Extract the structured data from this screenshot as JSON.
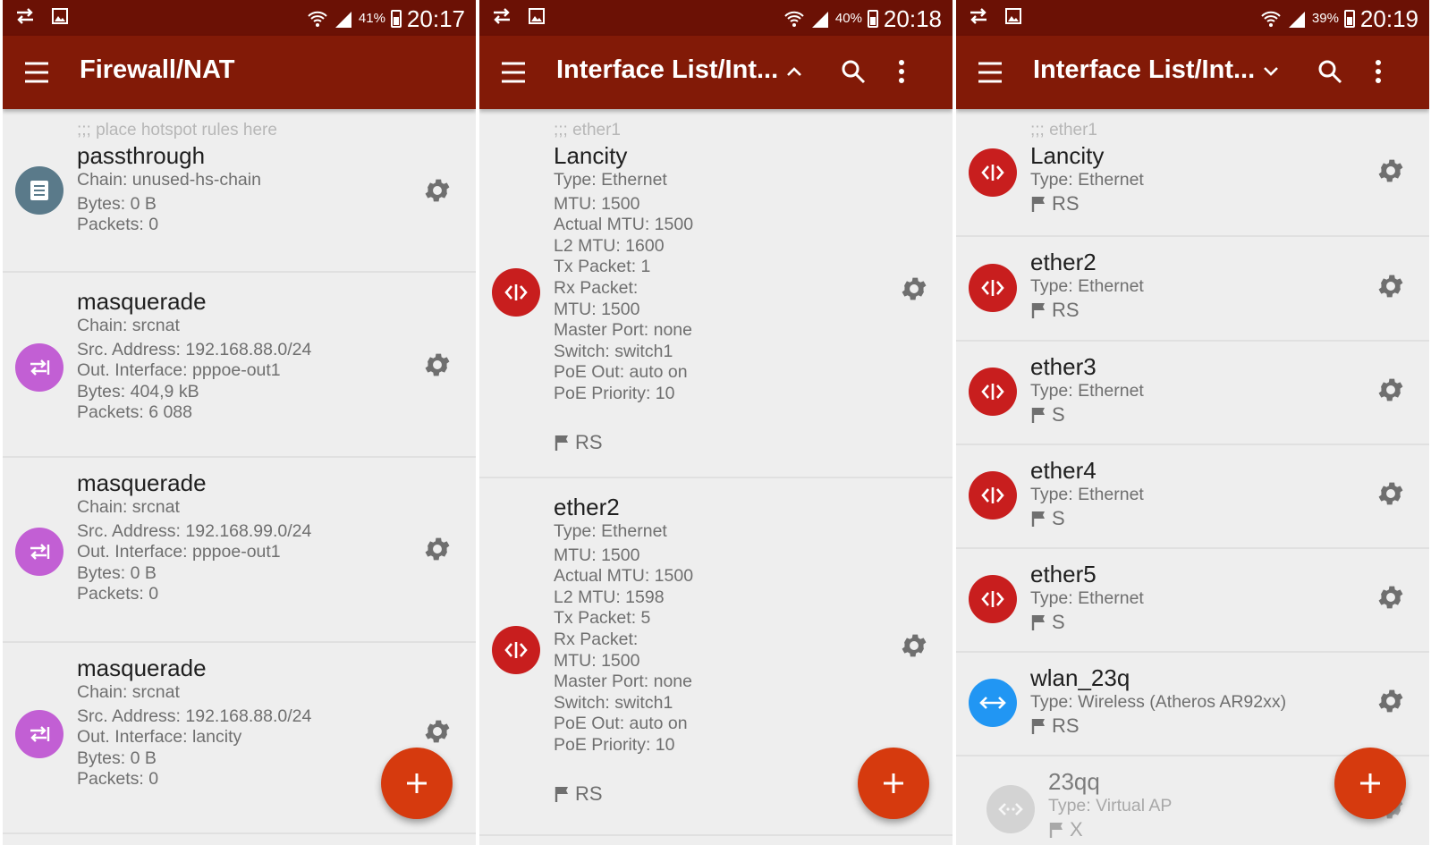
{
  "colors": {
    "statusbar": "#6b1105",
    "appbar": "#821a07",
    "fab": "#d63a0e",
    "interface_icon": "#c81e1e",
    "nat_icon": "#c25fd4",
    "wireless_icon": "#2196f3"
  },
  "screens": [
    {
      "status": {
        "battery": "41%",
        "time": "20:17"
      },
      "title": "Firewall/NAT",
      "items": [
        {
          "comment": ";;; place hotspot rules here",
          "name": "passthrough",
          "details": [
            "Chain: unused-hs-chain",
            "Bytes: 0 B",
            "Packets: 0"
          ],
          "icon": "list-icon"
        },
        {
          "name": "masquerade",
          "details": [
            "Chain: srcnat",
            "Src. Address: 192.168.88.0/24",
            "Out. Interface: pppoe-out1",
            "Bytes: 404,9 kB",
            "Packets: 6 088"
          ],
          "icon": "nat-icon"
        },
        {
          "name": "masquerade",
          "details": [
            "Chain: srcnat",
            "Src. Address: 192.168.99.0/24",
            "Out. Interface: pppoe-out1",
            "Bytes: 0 B",
            "Packets: 0"
          ],
          "icon": "nat-icon"
        },
        {
          "name": "masquerade",
          "details": [
            "Chain: srcnat",
            "Src. Address: 192.168.88.0/24",
            "Out. Interface: lancity",
            "Bytes: 0 B",
            "Packets: 0"
          ],
          "icon": "nat-icon"
        }
      ]
    },
    {
      "status": {
        "battery": "40%",
        "time": "20:18"
      },
      "title": "Interface List/Int...",
      "items": [
        {
          "comment": ";;; ether1",
          "name": "Lancity",
          "details": [
            "Type: Ethernet",
            "MTU: 1500",
            "Actual MTU: 1500",
            "L2 MTU: 1600",
            "Tx Packet: 1",
            "Rx Packet:",
            "MTU: 1500",
            "Master Port: none",
            "Switch: switch1",
            "PoE Out: auto on",
            "PoE Priority: 10"
          ],
          "flags": "RS"
        },
        {
          "name": "ether2",
          "details": [
            "Type: Ethernet",
            "MTU: 1500",
            "Actual MTU: 1500",
            "L2 MTU: 1598",
            "Tx Packet: 5",
            "Rx Packet:",
            "MTU: 1500",
            "Master Port: none",
            "Switch: switch1",
            "PoE Out: auto on",
            "PoE Priority: 10"
          ],
          "flags": "RS"
        }
      ]
    },
    {
      "status": {
        "battery": "39%",
        "time": "20:19"
      },
      "title": "Interface List/Int...",
      "items": [
        {
          "comment": ";;; ether1",
          "name": "Lancity",
          "type": "Type: Ethernet",
          "flags": "RS"
        },
        {
          "name": "ether2",
          "type": "Type: Ethernet",
          "flags": "RS"
        },
        {
          "name": "ether3",
          "type": "Type: Ethernet",
          "flags": "S"
        },
        {
          "name": "ether4",
          "type": "Type: Ethernet",
          "flags": "S"
        },
        {
          "name": "ether5",
          "type": "Type: Ethernet",
          "flags": "S"
        },
        {
          "name": "wlan_23q",
          "type": "Type: Wireless (Atheros AR92xx)",
          "flags": "RS"
        },
        {
          "name": "23qq",
          "type": "Type: Virtual AP",
          "flags": "X"
        }
      ]
    }
  ]
}
